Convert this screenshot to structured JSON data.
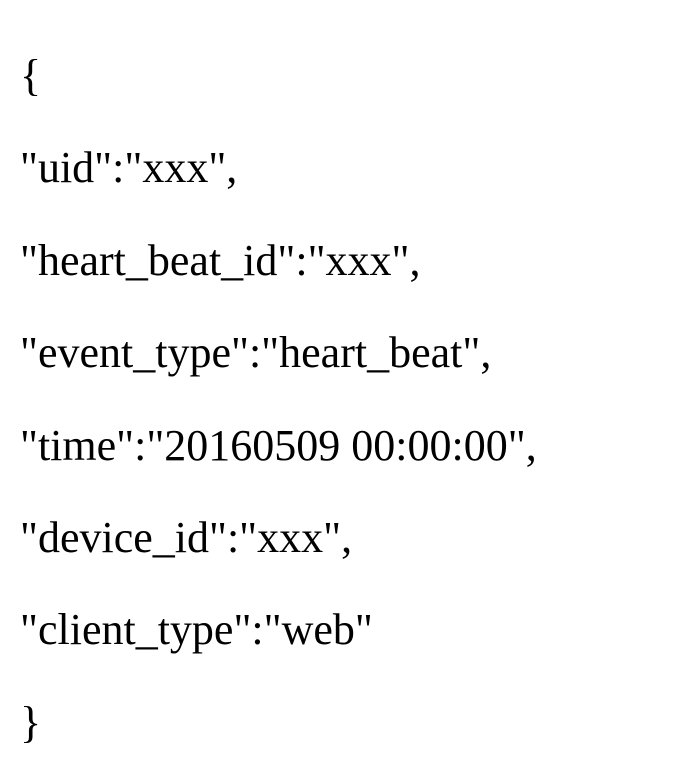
{
  "lines": {
    "open_brace": "{",
    "uid": "\"uid\":\"xxx\",",
    "heart_beat_id": "\"heart_beat_id\":\"xxx\",",
    "event_type": "\"event_type\":\"heart_beat\",",
    "time": "\"time\":\"20160509 00:00:00\",",
    "device_id": "\"device_id\":\"xxx\",",
    "client_type": "\"client_type\":\"web\"",
    "close_brace": "}"
  }
}
